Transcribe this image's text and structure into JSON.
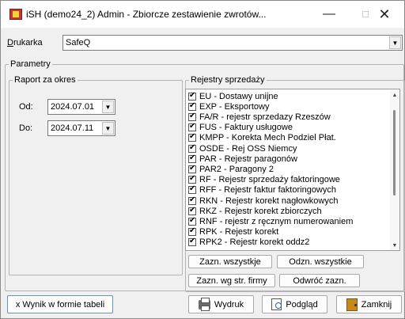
{
  "window": {
    "title": "iSH (demo24_2) Admin - Zbiorcze zestawienie zwrotów...",
    "minimize": "—",
    "maximize": "☐",
    "close": "✕"
  },
  "printer": {
    "label": "Drukarka",
    "value": "SafeQ"
  },
  "params": {
    "legend": "Parametry",
    "period": {
      "legend": "Raport za okres",
      "from_label": "Od:",
      "from_value": "2024.07.01",
      "to_label": "Do:",
      "to_value": "2024.07.11"
    }
  },
  "registers": {
    "legend": "Rejestry sprzedaży",
    "items": [
      {
        "label": "EU - Dostawy unijne",
        "checked": true
      },
      {
        "label": "EXP - Eksportowy",
        "checked": true
      },
      {
        "label": "FA/R - rejestr sprzedazy Rzeszów",
        "checked": true
      },
      {
        "label": "FUS - Faktury usługowe",
        "checked": true
      },
      {
        "label": "KMPP - Korekta Mech Podziel Płat.",
        "checked": true
      },
      {
        "label": "OSDE - Rej OSS Niemcy",
        "checked": true
      },
      {
        "label": "PAR - Rejestr paragonów",
        "checked": true
      },
      {
        "label": "PAR2 - Paragony 2",
        "checked": true
      },
      {
        "label": "RF - Rejestr sprzedaży faktoringowe",
        "checked": true
      },
      {
        "label": "RFF - Rejestr faktur faktoringowych",
        "checked": true
      },
      {
        "label": "RKN - Rejestr korekt nagłowkowych",
        "checked": true
      },
      {
        "label": "RKZ - Rejestr korekt zbiorczych",
        "checked": true
      },
      {
        "label": "RNF - rejestr z ręcznym numerowaniem",
        "checked": true
      },
      {
        "label": "RPK - Rejestr korekt",
        "checked": true
      },
      {
        "label": "RPK2 - Rejestr korekt oddz2",
        "checked": true
      }
    ],
    "select_all": "Zazn. wszystkje",
    "deselect_all": "Odzn. wszystkie",
    "select_firm": "Zazn. wg str. firmy",
    "invert": "Odwróć zazn."
  },
  "footer": {
    "table_checkbox": "x Wynik w formie tabeli",
    "print": "Wydruk",
    "preview": "Podgląd",
    "close": "Zamknij"
  }
}
